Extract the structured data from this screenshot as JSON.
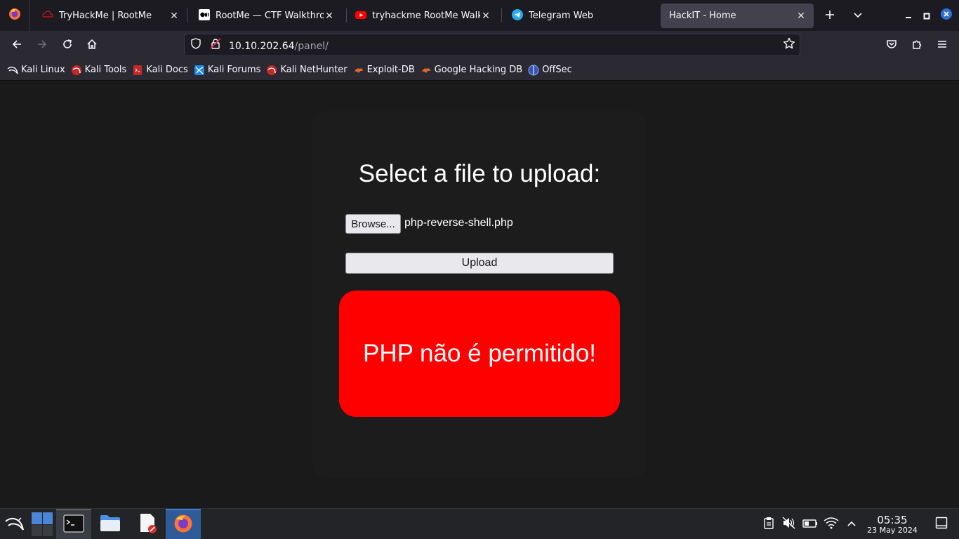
{
  "browser": {
    "tabs": [
      {
        "title": "TryHackMe | RootMe",
        "icon": "tryhackme-icon",
        "active": false
      },
      {
        "title": "RootMe — CTF Walkthrough",
        "icon": "medium-icon",
        "active": false
      },
      {
        "title": "tryhackme RootMe Walkthrough",
        "icon": "youtube-icon",
        "active": false
      },
      {
        "title": "Telegram Web",
        "icon": "telegram-icon",
        "active": false
      },
      {
        "title": "HackIT - Home",
        "icon": "",
        "active": true
      }
    ],
    "url_host": "10.10.202.64",
    "url_path": "/panel/",
    "bookmarks": [
      {
        "label": "Kali Linux",
        "icon": "kali-dragon-icon"
      },
      {
        "label": "Kali Tools",
        "icon": "kali-tools-icon"
      },
      {
        "label": "Kali Docs",
        "icon": "kali-docs-icon"
      },
      {
        "label": "Kali Forums",
        "icon": "kali-forums-icon"
      },
      {
        "label": "Kali NetHunter",
        "icon": "kali-nethunter-icon"
      },
      {
        "label": "Exploit-DB",
        "icon": "exploit-db-icon"
      },
      {
        "label": "Google Hacking DB",
        "icon": "ghdb-icon"
      },
      {
        "label": "OffSec",
        "icon": "offsec-icon"
      }
    ]
  },
  "page": {
    "heading": "Select a file to upload:",
    "browse_label": "Browse...",
    "selected_file": "php-reverse-shell.php",
    "upload_label": "Upload",
    "error_message": "PHP não é permitido!"
  },
  "taskbar": {
    "time": "05:35",
    "date": "23 May 2024"
  },
  "colors": {
    "error_bg": "#ff0000",
    "page_bg": "#1a1a1b",
    "card_bg": "#1c1c1c"
  }
}
